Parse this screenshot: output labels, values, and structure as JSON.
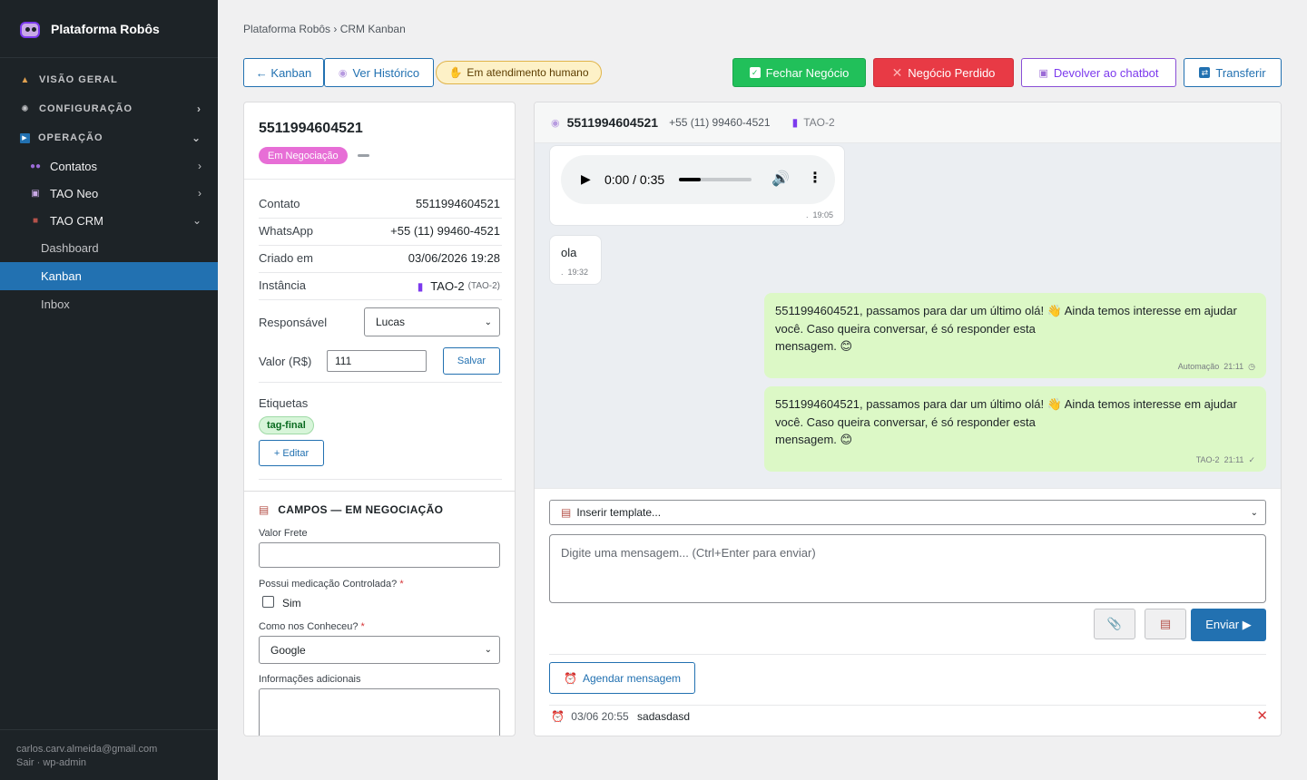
{
  "sidebar": {
    "brand": "Plataforma Robôs",
    "sections": [
      {
        "label": "VISÃO GERAL",
        "icon": "home-icon"
      },
      {
        "label": "CONFIGURAÇÃO",
        "icon": "gear-icon"
      },
      {
        "label": "OPERAÇÃO",
        "icon": "play-icon"
      }
    ],
    "subitems": [
      {
        "label": "Contatos",
        "icon": "users-icon"
      },
      {
        "label": "TAO Neo",
        "icon": "robot-icon"
      },
      {
        "label": "TAO CRM",
        "icon": "briefcase-icon"
      }
    ],
    "leaves": [
      "Dashboard",
      "Kanban",
      "Inbox"
    ],
    "active_leaf": "Kanban",
    "footer_email": "carlos.carv.almeida@gmail.com",
    "footer_links": "Sair · wp-admin"
  },
  "breadcrumb": "Plataforma Robôs › CRM Kanban",
  "toolbar": {
    "back": "← Kanban",
    "history": "Ver Histórico",
    "human_badge": "Em atendimento humano",
    "close_deal": "Fechar Negócio",
    "lost_deal": "Negócio Perdido",
    "return_chatbot": "Devolver ao chatbot",
    "transfer": "Transferir"
  },
  "colors": {
    "accent": "#2271b1",
    "success": "#21c05a",
    "danger": "#e83a45",
    "purple": "#7c3aed",
    "stage": "#e76ed6"
  },
  "deal": {
    "title": "5511994604521",
    "stage": "Em Negociação",
    "fields": [
      {
        "label": "Contato",
        "value": "5511994604521"
      },
      {
        "label": "WhatsApp",
        "value": "+55 (11) 99460-4521"
      },
      {
        "label": "Criado em",
        "value": "03/06/2026 19:28"
      },
      {
        "label": "Instância",
        "value": "TAO-2",
        "extra": "(TAO-2)"
      }
    ],
    "responsavel_label": "Responsável",
    "responsavel_value": "Lucas",
    "valor_label": "Valor (R$)",
    "valor_value": "111",
    "save": "Salvar",
    "tags_label": "Etiquetas",
    "tag": "tag-final",
    "edit_tags": "+ Editar"
  },
  "campos": {
    "heading": "CAMPOS — EM NEGOCIAÇÃO",
    "valor_frete": "Valor Frete",
    "medicacao": "Possui medicação Controlada?",
    "sim": "Sim",
    "conheceu": "Como nos Conheceu?",
    "conheceu_value": "Google",
    "info": "Informações adicionais",
    "required_mark": "*"
  },
  "chat": {
    "header_name": "5511994604521",
    "header_phone": "+55 (11) 99460-4521",
    "header_instance": "TAO-2",
    "audio_time": "0:00 / 0:35",
    "audio_progress": 0.3,
    "audio_msg_time": "19:05",
    "msg_ola": "ola",
    "msg_ola_time": "19:32",
    "out_text_1": "5511994604521, passamos para dar um último olá! 👋 Ainda temos interesse em ajudar",
    "out_text_2": "você. Caso queira conversar, é só responder esta",
    "out_text_3": "mensagem. 😊",
    "out1_sender": "Automação",
    "out1_time": "21:11",
    "out2_sender": "TAO-2",
    "out2_time": "21:11",
    "template_placeholder": "Inserir template...",
    "input_placeholder": "Digite uma mensagem... (Ctrl+Enter para enviar)",
    "send": "Enviar ▶",
    "schedule": "Agendar mensagem",
    "scheduled_time": "03/06 20:55",
    "scheduled_text": "sadasdasd"
  }
}
